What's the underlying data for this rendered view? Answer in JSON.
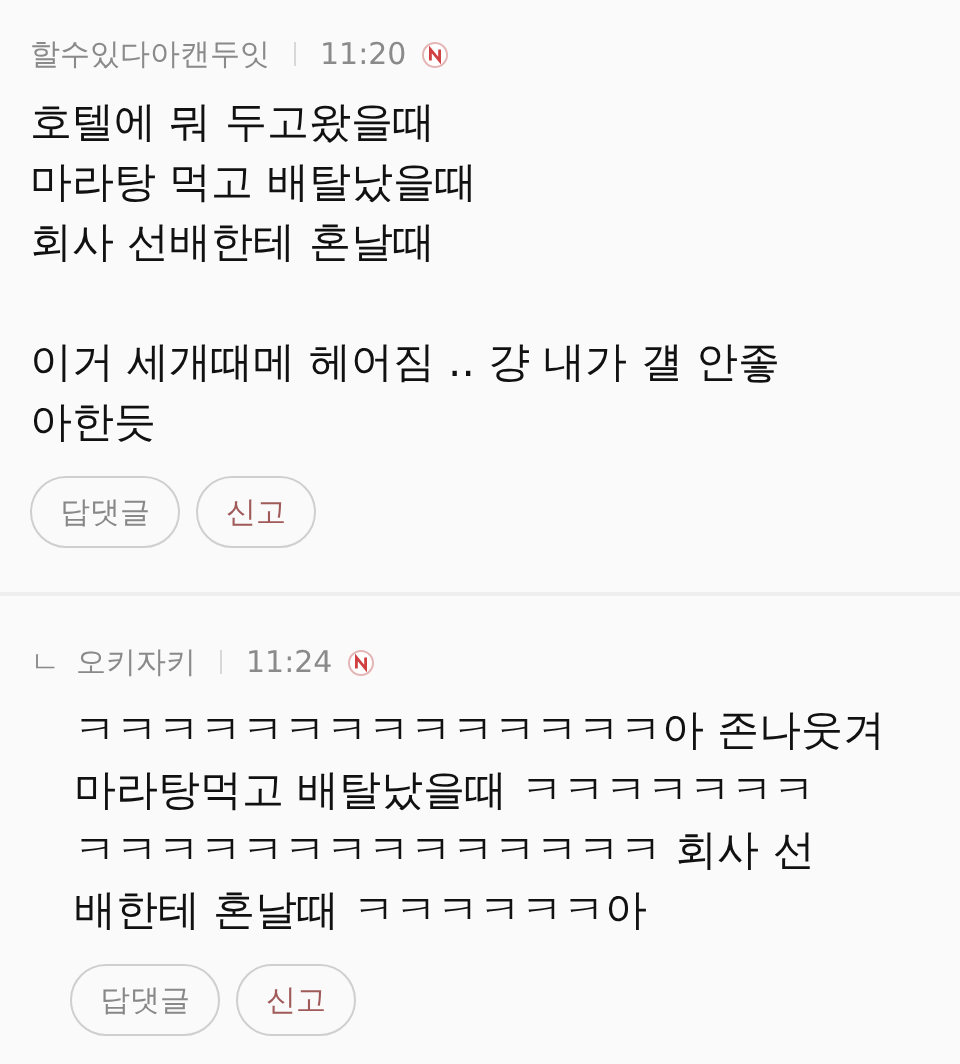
{
  "comments": [
    {
      "kind": "comment",
      "author": "할수있다아캔두잇",
      "time": "11:20",
      "paragraphs": [
        [
          "호텔에 뭐 두고왔을때",
          "마라탕 먹고 배탈났을때",
          "회사 선배한테 혼날때"
        ],
        [
          "이거 세개때메 헤어짐 .. 걍 내가 걜 안좋",
          "아한듯"
        ]
      ],
      "buttons": [
        "답댓글",
        "신고"
      ]
    },
    {
      "kind": "reply",
      "marker": "ㄴ",
      "author": "오키자키",
      "time": "11:24",
      "paragraphs": [
        [
          "ㅋㅋㅋㅋㅋㅋㅋㅋㅋㅋㅋㅋㅋㅋ아 존나웃겨",
          "마라탕먹고 배탈났을때 ㅋㅋㅋㅋㅋㅋㅋ",
          "ㅋㅋㅋㅋㅋㅋㅋㅋㅋㅋㅋㅋㅋㅋ 회사 선",
          "배한테 혼날때 ㅋㅋㅋㅋㅋㅋ아"
        ]
      ],
      "buttons": [
        "답댓글",
        "신고"
      ]
    }
  ]
}
